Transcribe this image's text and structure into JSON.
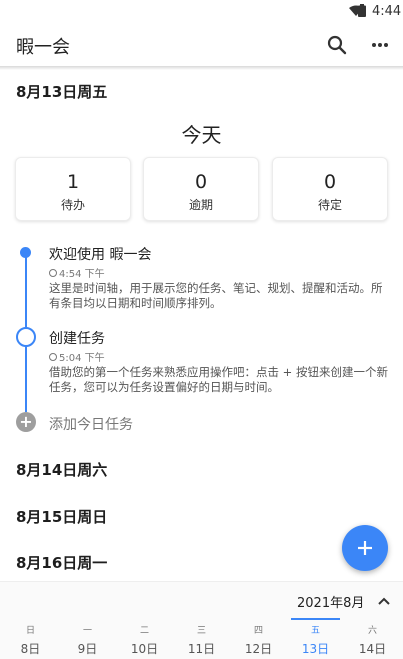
{
  "status_bar": {
    "time": "4:44",
    "wifi_icon": "wifi-icon",
    "battery_icon": "battery-icon"
  },
  "app_bar": {
    "title": "暇一会",
    "search_icon": "search-icon",
    "more_icon": "more-icon"
  },
  "today": {
    "heading": "8月13日周五",
    "label": "今天",
    "stats": [
      {
        "value": "1",
        "label": "待办"
      },
      {
        "value": "0",
        "label": "逾期"
      },
      {
        "value": "0",
        "label": "待定"
      }
    ],
    "tasks": [
      {
        "title": "欢迎使用 暇一会",
        "time": "4:54 下午",
        "desc": "这里是时间轴，用于展示您的任务、笔记、规划、提醒和活动。所有条目均以日期和时间顺序排列。"
      },
      {
        "title": "创建任务",
        "time": "5:04 下午",
        "desc": "借助您的第一个任务来熟悉应用操作吧：点击 + 按钮来创建一个新任务，您可以为任务设置偏好的日期与时间。"
      }
    ],
    "add_task": "添加今日任务"
  },
  "days": [
    "8月14日周六",
    "8月15日周日",
    "8月16日周一"
  ],
  "bottom": {
    "month": "2021年8月",
    "week": [
      {
        "weekday": "日",
        "date": "8日"
      },
      {
        "weekday": "一",
        "date": "9日"
      },
      {
        "weekday": "二",
        "date": "10日"
      },
      {
        "weekday": "三",
        "date": "11日"
      },
      {
        "weekday": "四",
        "date": "12日"
      },
      {
        "weekday": "五",
        "date": "13日"
      },
      {
        "weekday": "六",
        "date": "14日"
      }
    ],
    "selected_day": "13日"
  },
  "colors": {
    "accent": "#3b86f7",
    "text": "#212121",
    "muted": "#777777"
  }
}
